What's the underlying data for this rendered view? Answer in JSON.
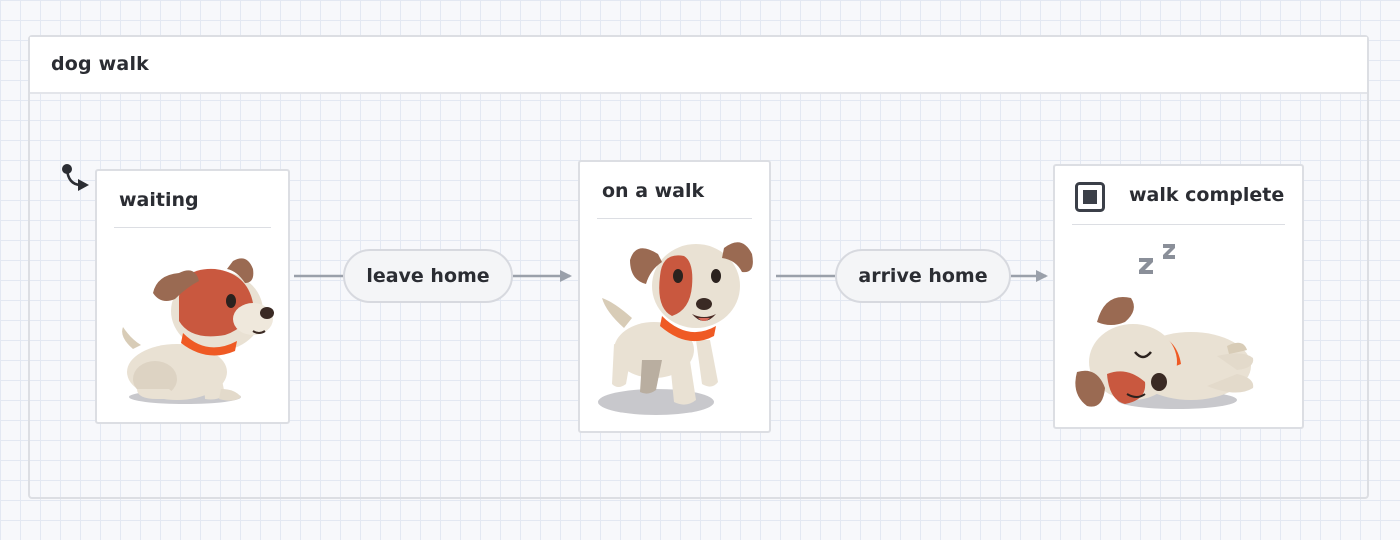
{
  "machine": {
    "title": "dog walk"
  },
  "states": [
    {
      "id": "waiting",
      "label": "waiting",
      "initial": true,
      "final": false
    },
    {
      "id": "on-a-walk",
      "label": "on a walk",
      "initial": false,
      "final": false
    },
    {
      "id": "walk-complete",
      "label": "walk complete",
      "initial": false,
      "final": true
    }
  ],
  "transitions": [
    {
      "event": "leave home",
      "from": "waiting",
      "to": "on-a-walk"
    },
    {
      "event": "arrive home",
      "from": "on-a-walk",
      "to": "walk-complete"
    }
  ],
  "icons": {
    "initial": "initial-state-arrow-icon",
    "final": "final-state-icon"
  },
  "colors": {
    "dog_body": "#e9e1d3",
    "dog_patch": "#c9583f",
    "dog_ears": "#9a6a52",
    "dog_collar": "#ef5a24",
    "edge": "#9aa0aa"
  }
}
